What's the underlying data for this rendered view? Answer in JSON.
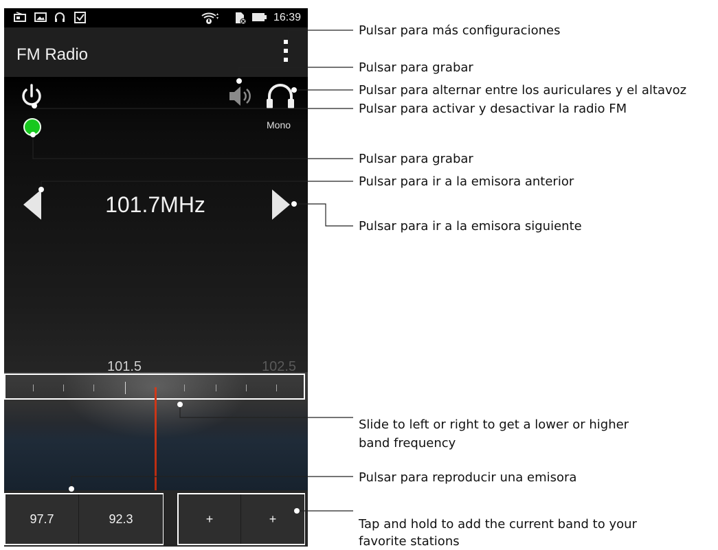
{
  "status_bar": {
    "time": "16:39",
    "left_icons": [
      "radio-icon",
      "image-icon",
      "headset-icon",
      "checkbox-icon"
    ],
    "right_icons": [
      "wifi-icon",
      "sim-icon",
      "battery-icon"
    ]
  },
  "app_bar": {
    "title": "FM Radio"
  },
  "controls": {
    "audio_mode": "Mono",
    "frequency": "101.7MHz",
    "led_color": "#17c81e"
  },
  "tuner": {
    "scale_labels": [
      "101.5",
      "102.5"
    ],
    "needle_color": "#d23a1a"
  },
  "presets": [
    {
      "label": "97.7"
    },
    {
      "label": "92.3"
    },
    {
      "label": "+"
    },
    {
      "label": "+"
    }
  ],
  "callouts": [
    "Pulsar para más configuraciones",
    "Pulsar para grabar",
    "Pulsar para alternar entre los auriculares y el altavoz",
    "Pulsar para activar y desactivar la radio FM",
    "Pulsar para grabar",
    "Pulsar para ir a la emisora anterior",
    "Pulsar para ir a la emisora siguiente",
    "Slide to left or right to get a lower or higher",
    "band frequency",
    "Pulsar para reproducir una emisora",
    "Tap and hold to add the current band to your",
    "favorite stations"
  ]
}
